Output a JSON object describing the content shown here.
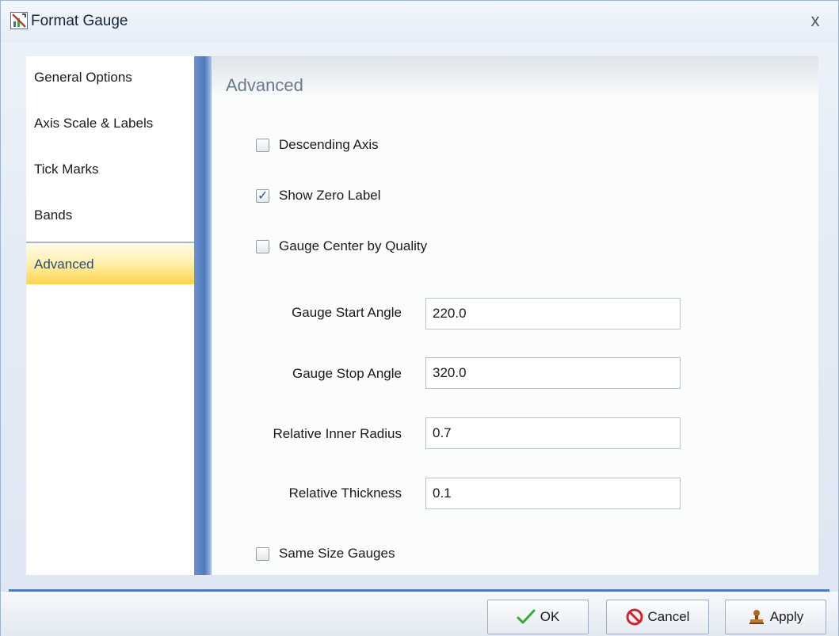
{
  "window": {
    "title": "Format Gauge",
    "close_label": "x",
    "icon": "format-gauge-icon"
  },
  "nav": {
    "items": [
      {
        "label": "General Options"
      },
      {
        "label": "Axis Scale & Labels"
      },
      {
        "label": "Tick Marks"
      },
      {
        "label": "Bands"
      },
      {
        "label": "Advanced",
        "selected": true
      }
    ]
  },
  "panel": {
    "title": "Advanced",
    "checkboxes": {
      "descending_axis": {
        "label": "Descending Axis",
        "checked": false
      },
      "show_zero_label": {
        "label": "Show Zero Label",
        "checked": true
      },
      "gauge_center_by_quality": {
        "label": "Gauge Center by Quality",
        "checked": false
      },
      "same_size_gauges": {
        "label": "Same Size Gauges",
        "checked": false
      }
    },
    "fields": {
      "start_angle": {
        "label": "Gauge Start Angle",
        "value": "220.0"
      },
      "stop_angle": {
        "label": "Gauge Stop Angle",
        "value": "320.0"
      },
      "inner_radius": {
        "label": "Relative Inner Radius",
        "value": "0.7"
      },
      "thickness": {
        "label": "Relative Thickness",
        "value": "0.1"
      }
    }
  },
  "buttons": {
    "ok": {
      "label": "OK",
      "icon": "checkmark-icon"
    },
    "cancel": {
      "label": "Cancel",
      "icon": "no-entry-icon"
    },
    "apply": {
      "label": "Apply",
      "icon": "stamp-icon"
    }
  },
  "colors": {
    "accent_blue": "#4f78be",
    "selection_yellow": "#ffd54e",
    "ok_green": "#3aa935",
    "cancel_red": "#d2232a"
  }
}
